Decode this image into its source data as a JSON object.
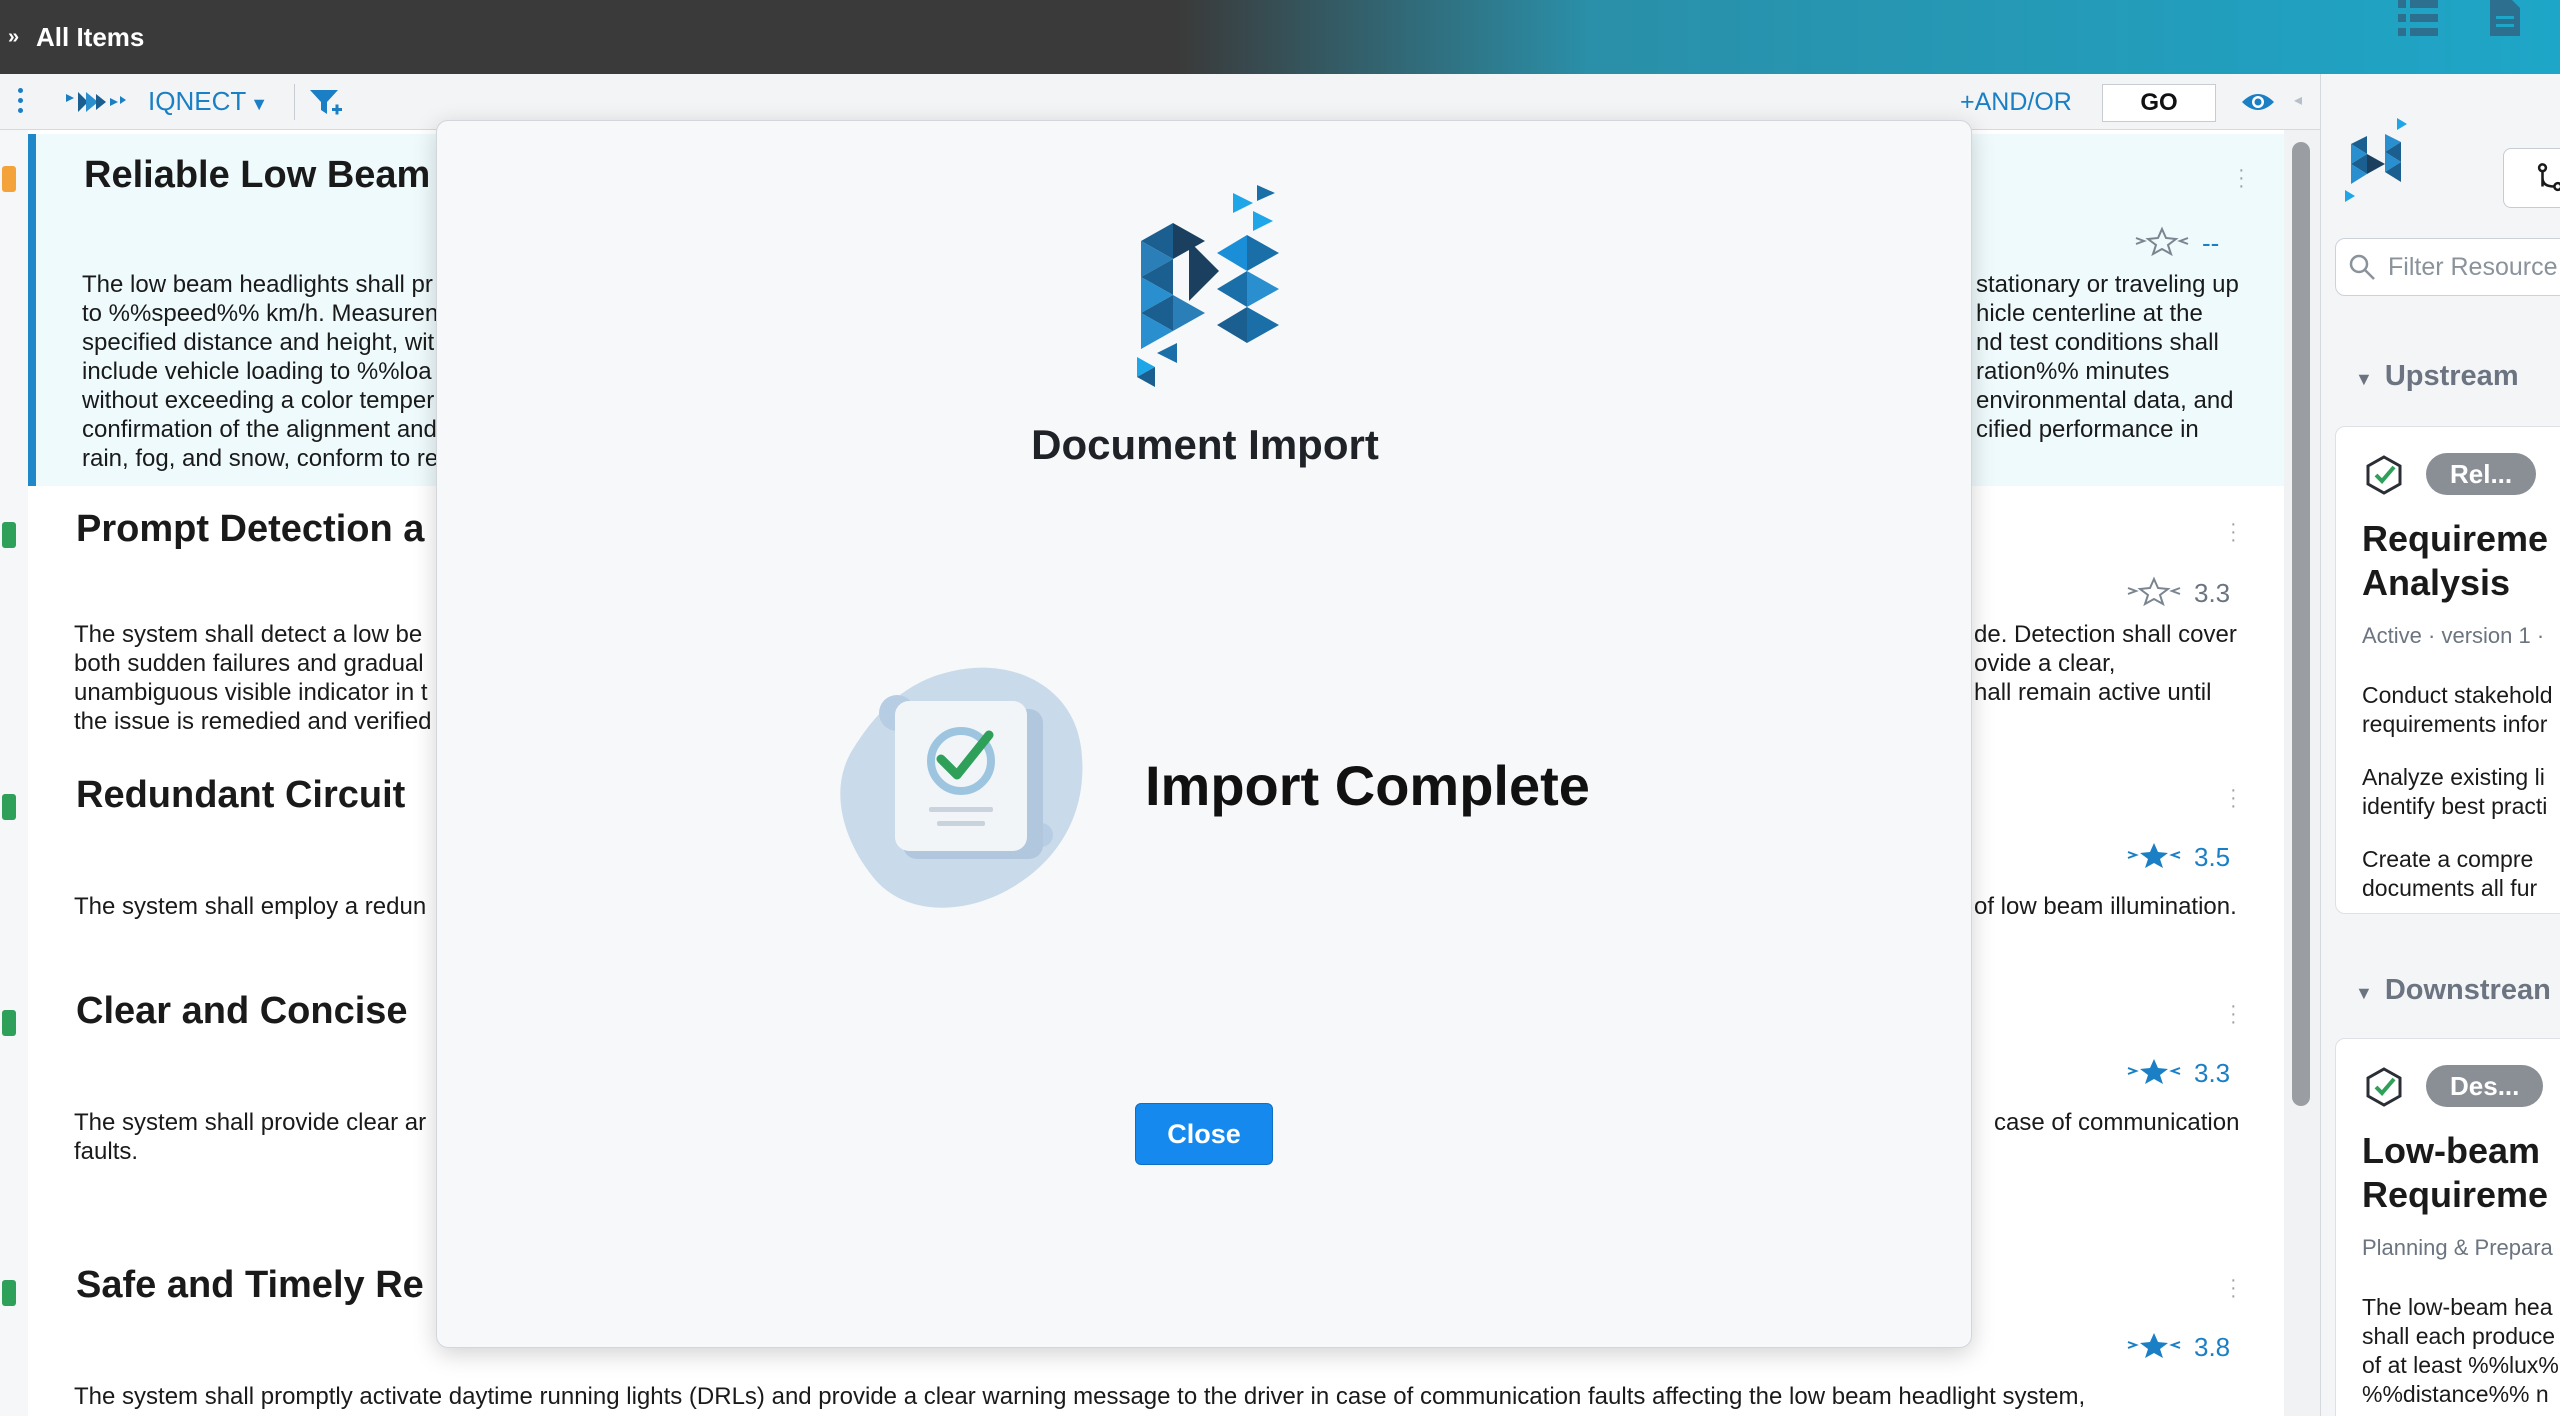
{
  "header": {
    "expand_glyph": "»",
    "title": "All Items",
    "icons": [
      "list-view-icon",
      "document-icon"
    ]
  },
  "toolbar": {
    "menu_icon": "kebab-vertical-icon",
    "brand_icon": "iqnect-logo-icon",
    "product": "IQNECT",
    "product_caret": "▼",
    "filter_icon": "filter-add-icon",
    "andor": "+AND/OR",
    "go": "GO",
    "eye_icon": "eye-icon",
    "arrows": "◂ ▸"
  },
  "items": [
    {
      "title": "Reliable Low Beam",
      "rating": "--",
      "selected": true,
      "text_left": [
        "The low beam headlights shall pr",
        "to %%speed%% km/h. Measuren",
        "specified distance and height, wit",
        "include vehicle loading to %%loa",
        "without exceeding a color temper",
        "confirmation of the alignment and",
        "rain, fog, and snow, conform to re"
      ],
      "text_right": [
        "stationary or traveling up",
        "hicle centerline at the",
        "nd test conditions shall",
        "ration%% minutes",
        "environmental data, and",
        "cified performance in",
        ""
      ]
    },
    {
      "title": "Prompt Detection a",
      "rating": "3.3",
      "text_left": [
        "The system shall detect a low be",
        "both sudden failures and gradual",
        "unambiguous visible indicator in t",
        "the issue is remedied and verified"
      ],
      "text_right": [
        "de. Detection shall cover",
        "ovide a clear,",
        "hall remain active until",
        ""
      ]
    },
    {
      "title": "Redundant Circuit",
      "rating": "3.5",
      "text_left": [
        "The system shall employ a redun"
      ],
      "text_right": [
        "of low beam illumination."
      ]
    },
    {
      "title": "Clear and Concise",
      "rating": "3.3",
      "text_left": [
        "The system shall provide clear ar",
        "faults."
      ],
      "text_right": [
        "case of communication",
        ""
      ]
    },
    {
      "title": "Safe and Timely Re",
      "rating": "3.8",
      "text_left": [
        "The system shall promptly activate daytime running lights (DRLs) and provide a clear warning message to the driver in case of communication faults affecting the low beam headlight system,"
      ],
      "text_right": [
        ""
      ]
    }
  ],
  "right_panel": {
    "filter_placeholder": "Filter Resource",
    "upstream_label": "Upstream",
    "downstream_label": "Downstrean",
    "upstream_card": {
      "badge": "Rel...",
      "title_lines": [
        "Requireme",
        "Analysis"
      ],
      "meta": "Active · version 1 · ",
      "lines": [
        "Conduct stakehold",
        "requirements infor",
        "Analyze existing li",
        "identify best practi",
        "Create a compre",
        "documents all fur"
      ]
    },
    "downstream_card": {
      "badge": "Des...",
      "title_lines": [
        "Low-beam",
        "Requireme"
      ],
      "meta": "Planning & Prepara",
      "lines": [
        "The low-beam hea",
        "shall each produce",
        "of at least %%lux%",
        "%%distance%% n"
      ]
    }
  },
  "modal": {
    "title": "Document Import",
    "status": "Import Complete",
    "close": "Close",
    "logo_icon": "brand-logo-icon",
    "illustration_icon": "document-check-icon"
  }
}
